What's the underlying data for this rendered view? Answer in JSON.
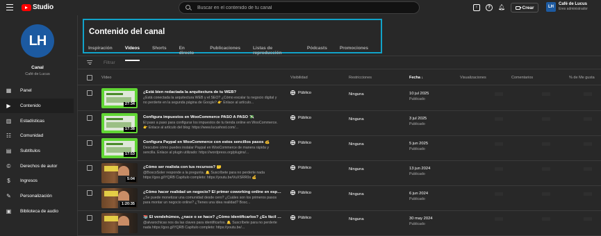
{
  "topbar": {
    "logo_text": "Studio",
    "search_placeholder": "Buscar en el contenido de tu canal",
    "create_label": "Crear",
    "account_initials": "LH",
    "account_name": "Café de Lucus",
    "account_role": "Eres administrador"
  },
  "sidebar": {
    "avatar_initials": "LH",
    "channel_label": "Canal",
    "channel_name": "Café de Lucus",
    "items": [
      {
        "label": "Panel",
        "icon": "dashboard-icon",
        "glyph": "▦"
      },
      {
        "label": "Contenido",
        "icon": "content-icon",
        "glyph": "▶",
        "active": true
      },
      {
        "label": "Estadísticas",
        "icon": "analytics-icon",
        "glyph": "▥"
      },
      {
        "label": "Comunidad",
        "icon": "community-icon",
        "glyph": "☷"
      },
      {
        "label": "Subtítulos",
        "icon": "subtitles-icon",
        "glyph": "▤"
      },
      {
        "label": "Derechos de autor",
        "icon": "copyright-icon",
        "glyph": "©"
      },
      {
        "label": "Ingresos",
        "icon": "earn-icon",
        "glyph": "$"
      },
      {
        "label": "Personalización",
        "icon": "customization-icon",
        "glyph": "✎"
      },
      {
        "label": "Biblioteca de audio",
        "icon": "audio-library-icon",
        "glyph": "▣"
      }
    ]
  },
  "main": {
    "title": "Contenido del canal",
    "tabs": [
      "Inspiración",
      "Vídeos",
      "Shorts",
      "En directo",
      "Publicaciones",
      "Listas de reproducción",
      "Pódcasts",
      "Promociones"
    ],
    "active_tab": 1,
    "filter_label": "Filtrar",
    "columns": {
      "video": "Vídeo",
      "visibility": "Visibilidad",
      "restrictions": "Restricciones",
      "date": "Fecha ↓",
      "views": "Visualizaciones",
      "comments": "Comentarios",
      "likes": "% de Me gusta"
    }
  },
  "videos": [
    {
      "title": "¿Está bien redactada la arquitectura de tu WEB?",
      "description": "¿Está conectada la arquitectura WEB y el SEO? ¿Cómo escalar tu negocio digital y no perderte en la segunda página de Google? 👉 Enlace al artículo...",
      "duration": "27:34",
      "thumb": "green",
      "visibility": "Público",
      "restrictions": "Ninguna",
      "date": "10 jul 2025",
      "status": "Publicado"
    },
    {
      "title": "Configura impuestos en WooCommerce PASO A PASO 💸",
      "description": "El paso a paso para configurar los impuestos de tu tienda online en WooCommerce. 👉 Enlace al artículo del blog: https://www.lucushost.com/...",
      "duration": "17:38",
      "thumb": "green",
      "visibility": "Público",
      "restrictions": "Ninguna",
      "date": "3 jul 2025",
      "status": "Publicado"
    },
    {
      "title": "Configura Paypal en WooCommerce con estos sencillos pasos 💰",
      "description": "Descubre cómo puedes instalar Paypal en WooCommerce de manera rápida y sencilla. Enlace al plugin utilizado: https://wordpress.org/plugins/...",
      "duration": "17:53",
      "thumb": "green",
      "visibility": "Público",
      "restrictions": "Ninguna",
      "date": "5 jun 2025",
      "status": "Publicado"
    },
    {
      "title": "¿Cómo ser realista con tus recursos? 🤔",
      "description": "@BoscoSoler responde a la pregunta. 🔔 Suscríbete para no perderte nada https://goo.gl/YQRB Capítulo completo: https://youtu.be/VuXSRR0o 💰",
      "duration": "5:04",
      "thumb": "person",
      "visibility": "Público",
      "restrictions": "Ninguna",
      "date": "13 jun 2024",
      "status": "Publicado"
    },
    {
      "title": "¿Cómo hacer realidad un negocio? El primer coworking online en españo...",
      "description": "¿Se puede monetizar una comunidad desde cero? ¿Cuáles son los primeros pasos para montar un negocio online? ¿Tienes una idea realidad? Bosc...",
      "duration": "1:20:35",
      "thumb": "person",
      "visibility": "Público",
      "restrictions": "Ninguna",
      "date": "6 jun 2024",
      "status": "Publicado"
    },
    {
      "title": "📚 El vendehúmos, ¿nace o se hace? ¿Cómo identificarlos? ¿Es fácil ser ...",
      "description": "@alvarochicas nos da las claves para identificarlos. 🔔 Suscríbete para no perderte nada https://goo.gl/YQRB Capítulo completo: https://youtu.be/...",
      "duration": "",
      "thumb": "person",
      "visibility": "Público",
      "restrictions": "Ninguna",
      "date": "30 may 2024",
      "status": "Publicado"
    }
  ]
}
